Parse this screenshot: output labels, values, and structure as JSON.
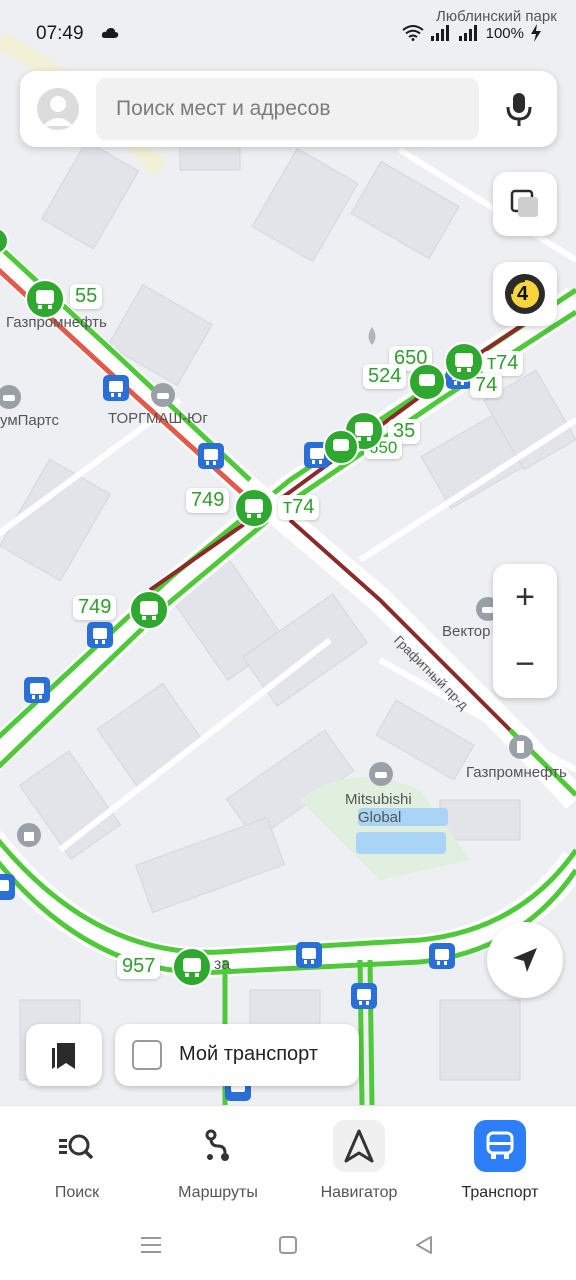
{
  "status_bar": {
    "time": "07:49",
    "battery": "100%",
    "icons": [
      "cloud-icon",
      "wifi-icon",
      "signal-icon",
      "battery-icon"
    ]
  },
  "search": {
    "placeholder": "Поиск мест и адресов"
  },
  "map": {
    "traffic_level": "4",
    "zoom_in": "+",
    "zoom_out": "−",
    "places": {
      "lyublinsky_park": "Люблинский парк",
      "gazpromneft_top": "Газпромнефть",
      "umparts": "умПартс",
      "torgmash": "ТОРГМАШ-Юг",
      "vektor_avto": "Вектор Авто",
      "grafitny": "Графитный пр-д",
      "gazpromneft_bottom": "Газпромнефть",
      "mitsubishi_1": "Mitsubishi",
      "mitsubishi_2": "Global",
      "street_fragment": "за"
    },
    "routes": {
      "r55": "55",
      "r650a": "650",
      "rt74a": "т74",
      "r524": "524",
      "r74": "74",
      "r35": "35",
      "r650b": "650",
      "r749a": "749",
      "rt74b": "т74",
      "r749b": "749",
      "r957": "957"
    }
  },
  "bottom_controls": {
    "my_transport": "Мой транспорт"
  },
  "tabs": [
    {
      "label": "Поиск",
      "icon": "search-icon"
    },
    {
      "label": "Маршруты",
      "icon": "routes-icon"
    },
    {
      "label": "Навигатор",
      "icon": "navigator-icon"
    },
    {
      "label": "Транспорт",
      "icon": "transport-icon",
      "active": true
    }
  ],
  "colors": {
    "accent": "#2d7ff9",
    "traffic_green": "#4fc83a",
    "traffic_red": "#e25a4b",
    "traffic_dark": "#8a2a2a",
    "transit_green": "#2fa82f",
    "stop_blue": "#2a6fd6"
  }
}
